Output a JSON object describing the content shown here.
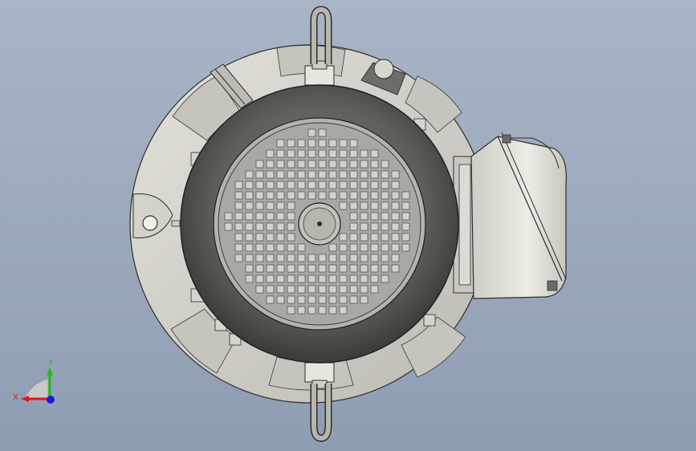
{
  "viewport": {
    "background_top": "#a9b5c6",
    "background_bottom": "#8f9db3"
  },
  "model": {
    "flange_color": "#d9d8d1",
    "fan_cover_color": "#5b5b59",
    "grille_color": "#9a9a97",
    "terminal_box_color": "#e3e2da",
    "edge_color": "#2d2d2d"
  },
  "triad": {
    "x_label": "X",
    "y_label": "Y",
    "x_color": "#e01818",
    "y_color": "#18c018",
    "z_color": "#1a1ad8"
  }
}
